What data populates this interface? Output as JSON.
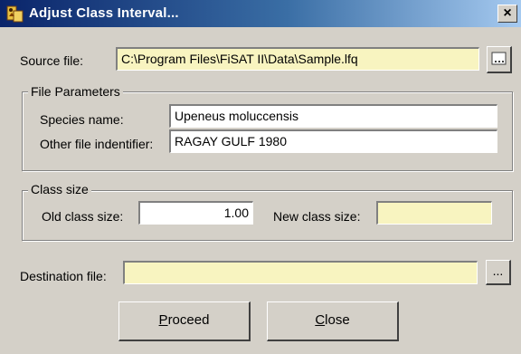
{
  "window": {
    "title": "Adjust Class Interval...",
    "close_glyph": "×",
    "icon": "app-icon"
  },
  "source": {
    "label": "Source file:",
    "value": "C:\\Program Files\\FiSAT II\\Data\\Sample.lfq",
    "browse_icon": "browse-icon"
  },
  "file_parameters": {
    "title": "File Parameters",
    "species_label": "Species name:",
    "species_value": "Upeneus moluccensis",
    "identifier_label": "Other file indentifier:",
    "identifier_value": "RAGAY GULF 1980"
  },
  "class_size": {
    "title": "Class size",
    "old_label": "Old class size:",
    "old_value": "1.00",
    "new_label": "New class size:",
    "new_value": ""
  },
  "destination": {
    "label": "Destination file:",
    "value": "",
    "browse_label": "..."
  },
  "buttons": {
    "proceed_mnemonic": "P",
    "proceed_rest": "roceed",
    "close_mnemonic": "C",
    "close_rest": "lose"
  },
  "colors": {
    "dialog_bg": "#d4d0c8",
    "title_start": "#0a246a",
    "title_end": "#a6caf0",
    "readonly_field": "#f8f4c0"
  }
}
